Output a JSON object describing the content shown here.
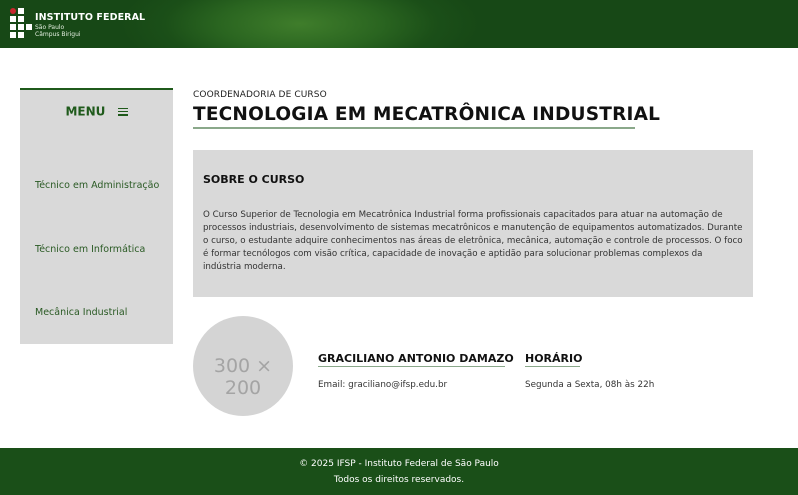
{
  "header": {
    "brand_title": "INSTITUTO FEDERAL",
    "brand_line1": "São Paulo",
    "brand_line2": "Câmpus Birigui",
    "colors": {
      "primary_green": "#1b4f18",
      "accent_red": "#c8282e"
    }
  },
  "sidebar": {
    "menu_label": "MENU",
    "menu_icon": "hamburger-icon",
    "items": [
      {
        "label": "Técnico em Administração"
      },
      {
        "label": "Técnico em Informática"
      },
      {
        "label": "Mecânica Industrial"
      }
    ]
  },
  "main": {
    "kicker": "COORDENADORIA DE CURSO",
    "title": "TECNOLOGIA EM MECATRÔNICA INDUSTRIAL",
    "about": {
      "heading": "SOBRE O CURSO",
      "text": "O Curso Superior de Tecnologia em Mecatrônica Industrial forma profissionais capacitados para atuar na automação de processos industriais, desenvolvimento de sistemas mecatrônicos e manutenção de equipamentos automatizados. Durante o curso, o estudante adquire conhecimentos nas áreas de eletrônica, mecânica, automação e controle de processos. O foco é formar tecnólogos com visão crítica, capacidade de inovação e aptidão para solucionar problemas complexos da indústria moderna."
    },
    "photo_placeholder": "300 × 200",
    "coordinator": {
      "name": "GRACILIANO ANTONIO DAMAZO",
      "email": "Email: graciliano@ifsp.edu.br"
    },
    "hours": {
      "title": "HORÁRIO",
      "text": "Segunda a Sexta, 08h às 22h"
    }
  },
  "footer": {
    "line1": "© 2025 IFSP - Instituto Federal de São Paulo",
    "line2": "Todos os direitos reservados."
  }
}
